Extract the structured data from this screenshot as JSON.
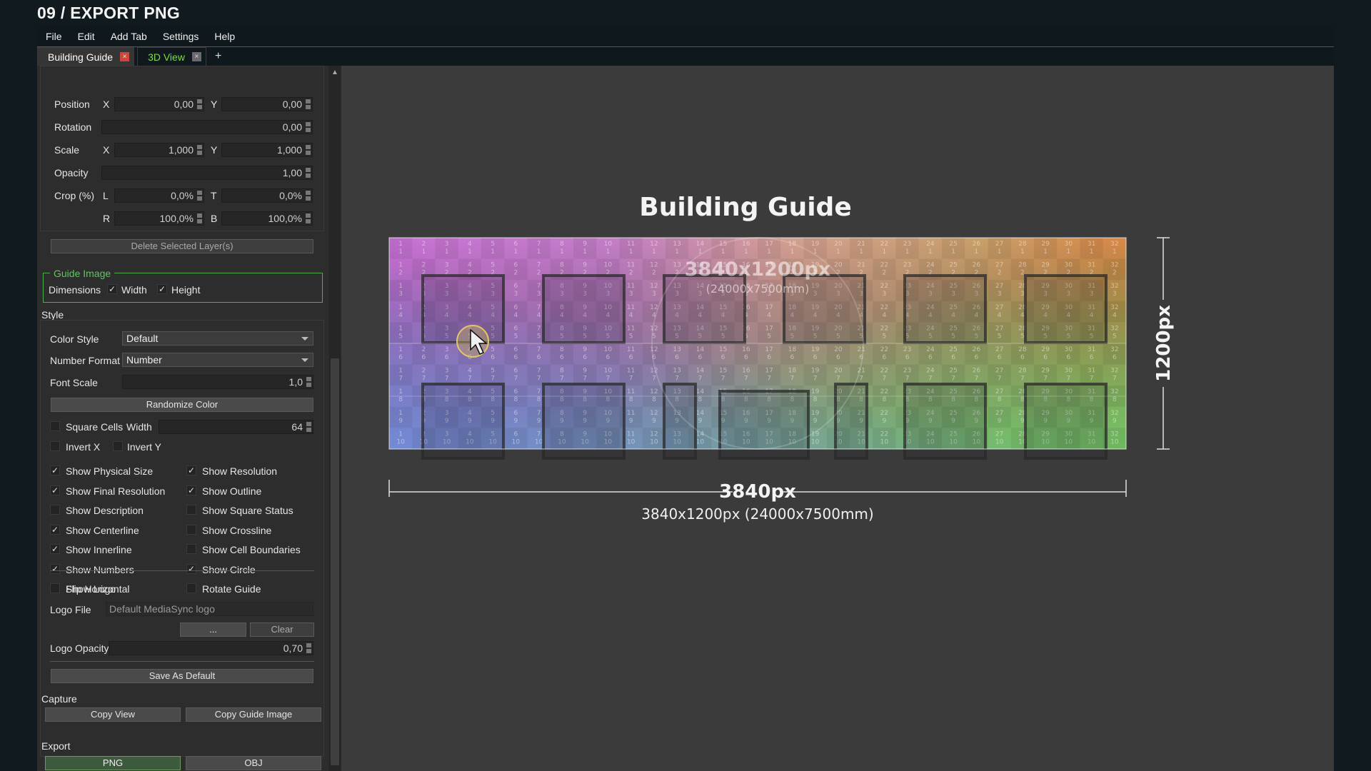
{
  "page_title": "09 / EXPORT PNG",
  "menu": [
    "File",
    "Edit",
    "Add Tab",
    "Settings",
    "Help"
  ],
  "tabs": [
    {
      "label": "Building Guide",
      "close": "×"
    },
    {
      "label": "3D View",
      "close": "×"
    }
  ],
  "tab_add": "+",
  "transform": {
    "position_label": "Position",
    "rotation_label": "Rotation",
    "scale_label": "Scale",
    "opacity_label": "Opacity",
    "crop_label": "Crop (%)",
    "x": "X",
    "y": "Y",
    "l": "L",
    "t": "T",
    "r": "R",
    "b": "B",
    "pos_x": "0,00",
    "pos_y": "0,00",
    "rotation": "0,00",
    "scale_x": "1,000",
    "scale_y": "1,000",
    "opacity": "1,00",
    "crop_l": "0,0%",
    "crop_t": "0,0%",
    "crop_r": "100,0%",
    "crop_b": "100,0%",
    "delete_button": "Delete Selected Layer(s)"
  },
  "guide_image": {
    "title": "Guide Image",
    "dimensions": "Dimensions",
    "width": "Width",
    "height": "Height",
    "width_checked": true,
    "height_checked": true
  },
  "style": {
    "title": "Style",
    "color_style_label": "Color Style",
    "color_style_value": "Default",
    "number_format_label": "Number Format",
    "number_format_value": "Number",
    "font_scale_label": "Font Scale",
    "font_scale_value": "1,0",
    "randomize_button": "Randomize Color",
    "square_cells": "Square Cells",
    "width_label": "Width",
    "width_value": "64",
    "invert_x": "Invert X",
    "invert_y": "Invert Y",
    "options_left": [
      {
        "label": "Show Physical Size",
        "checked": true
      },
      {
        "label": "Show Final Resolution",
        "checked": true
      },
      {
        "label": "Show Description",
        "checked": false
      },
      {
        "label": "Show Centerline",
        "checked": true
      },
      {
        "label": "Show Innerline",
        "checked": true
      },
      {
        "label": "Show Numbers",
        "checked": true
      },
      {
        "label": "Flip Horizontal",
        "checked": false
      }
    ],
    "options_right": [
      {
        "label": "Show Resolution",
        "checked": true
      },
      {
        "label": "Show Outline",
        "checked": true
      },
      {
        "label": "Show Square Status",
        "checked": false
      },
      {
        "label": "Show Crossline",
        "checked": false
      },
      {
        "label": "Show Cell Boundaries",
        "checked": false
      },
      {
        "label": "Show Circle",
        "checked": true
      },
      {
        "label": "Rotate Guide",
        "checked": false
      }
    ],
    "show_logo": "Show Logo",
    "logo_file_label": "Logo File",
    "logo_file_value": "Default MediaSync logo",
    "browse_button": "...",
    "clear_button": "Clear",
    "logo_opacity_label": "Logo Opacity",
    "logo_opacity_value": "0,70",
    "save_default_button": "Save As Default"
  },
  "capture": {
    "title": "Capture",
    "copy_view": "Copy View",
    "copy_guide": "Copy Guide Image"
  },
  "export": {
    "title": "Export",
    "png": "PNG",
    "obj": "OBJ"
  },
  "canvas": {
    "title": "Building Guide",
    "center_res": "3840x1200px",
    "center_mm": "(24000x7500mm)",
    "width_dim": "3840px",
    "height_dim": "1200px",
    "footer": "3840x1200px (24000x7500mm)",
    "columns": 32,
    "rows": 10
  },
  "colors": {
    "accent_green": "#4caf50",
    "tab_close_red": "#d2443a",
    "tab_green_text": "#7ddc3a"
  }
}
